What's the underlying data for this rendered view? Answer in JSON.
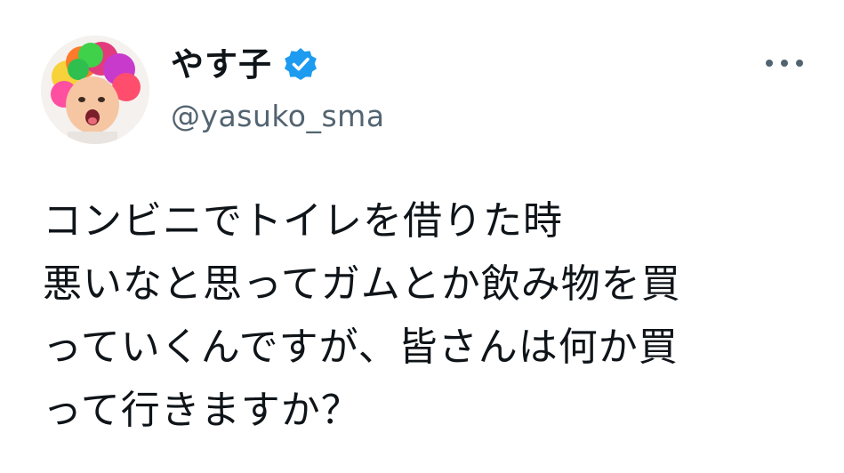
{
  "tweet": {
    "author": {
      "display_name": "やす子",
      "handle": "@yasuko_sma",
      "verified_icon": "verified-badge-icon",
      "avatar_icon": "avatar-photo"
    },
    "menu_icon": "more-options-icon",
    "text_lines": [
      "コンビニでトイレを借りた時",
      "悪いなと思ってガムとか飲み物を買",
      "っていくんですが、皆さんは何か買",
      "って行きますか？"
    ]
  },
  "colors": {
    "text_primary": "#0f1419",
    "text_secondary": "#536471",
    "verified_blue": "#1d9bf0",
    "background": "#ffffff"
  }
}
